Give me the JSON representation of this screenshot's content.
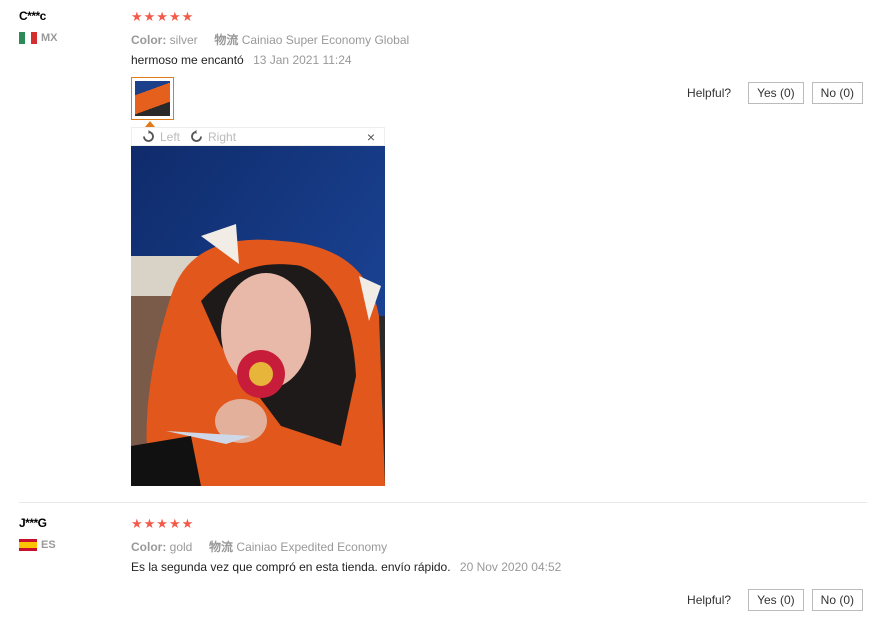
{
  "reviews": [
    {
      "user": "C***c",
      "country": "MX",
      "stars": "★★★★★",
      "color_label": "Color:",
      "color_value": "silver",
      "logistics_label": "物流",
      "logistics_value": "Cainiao Super Economy Global",
      "text": "hermoso me encantó",
      "date": "13 Jan 2021 11:24",
      "helpful_label": "Helpful?",
      "yes_label": "Yes (0)",
      "no_label": "No (0)",
      "viewer": {
        "rotate_left": "Left",
        "rotate_right": "Right",
        "close": "×"
      }
    },
    {
      "user": "J***G",
      "country": "ES",
      "stars": "★★★★★",
      "color_label": "Color:",
      "color_value": "gold",
      "logistics_label": "物流",
      "logistics_value": "Cainiao Expedited Economy",
      "text": "Es la segunda vez que compró en esta tienda. envío rápido.",
      "date": "20 Nov 2020 04:52",
      "helpful_label": "Helpful?",
      "yes_label": "Yes (0)",
      "no_label": "No (0)"
    }
  ],
  "colors": {
    "star": "#f45a4a",
    "thumb_border": "#e07b1a",
    "muted": "#999999"
  }
}
